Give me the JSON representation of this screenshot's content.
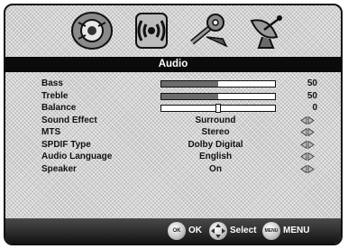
{
  "menu_title": "Audio",
  "tabs": [
    {
      "name": "picture",
      "icon": "picture-icon"
    },
    {
      "name": "audio",
      "icon": "speaker-signal-icon",
      "active": true
    },
    {
      "name": "setup",
      "icon": "tools-icon"
    },
    {
      "name": "channel",
      "icon": "satellite-dish-icon"
    }
  ],
  "settings": [
    {
      "label": "Bass",
      "type": "slider",
      "value": "50",
      "level": 0.5
    },
    {
      "label": "Treble",
      "type": "slider",
      "value": "50",
      "level": 0.5
    },
    {
      "label": "Balance",
      "type": "balance",
      "value": "0",
      "level": 0.5
    },
    {
      "label": "Sound Effect",
      "type": "option",
      "value": "Surround"
    },
    {
      "label": "MTS",
      "type": "option",
      "value": "Stereo"
    },
    {
      "label": "SPDIF Type",
      "type": "option",
      "value": "Dolby Digital"
    },
    {
      "label": "Audio Language",
      "type": "option",
      "value": "English"
    },
    {
      "label": "Speaker",
      "type": "option",
      "value": "On"
    }
  ],
  "footer": {
    "ok_button_text": "OK",
    "ok_label": "OK",
    "select_label": "Select",
    "menu_button_text": "MENU",
    "menu_label": "MENU"
  },
  "colors": {
    "title_bar": "#0b0b0b",
    "panel": "#d3d3d3",
    "footer": "#1e1e1e"
  }
}
